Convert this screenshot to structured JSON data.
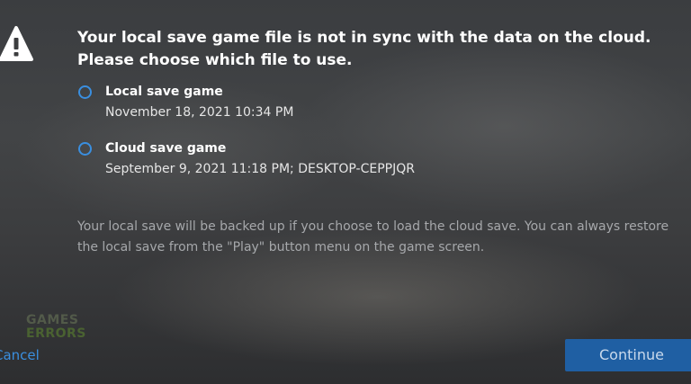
{
  "dialog": {
    "icon": "warning-icon",
    "heading_line1": "Your local save game file is not in sync with the data on the cloud.",
    "heading_line2": "Please choose which file to use.",
    "options": [
      {
        "label": "Local save game",
        "detail": "November 18, 2021 10:34 PM",
        "selected": false
      },
      {
        "label": "Cloud save game",
        "detail": "September 9, 2021 11:18 PM; DESKTOP-CEPPJQR",
        "selected": false
      }
    ],
    "note": "Your local save will be backed up if you choose to load the cloud save. You can always restore the local save from the \"Play\" button menu on the game screen.",
    "cancel_label": "Cancel",
    "continue_label": "Continue"
  },
  "watermark": {
    "line1": "GAMES",
    "line2": "ERRORS"
  },
  "colors": {
    "accent": "#3a8fe0",
    "button_bg": "#1f5fa3",
    "background": "#3c3d3f",
    "note_text": "#a6a8ab"
  }
}
